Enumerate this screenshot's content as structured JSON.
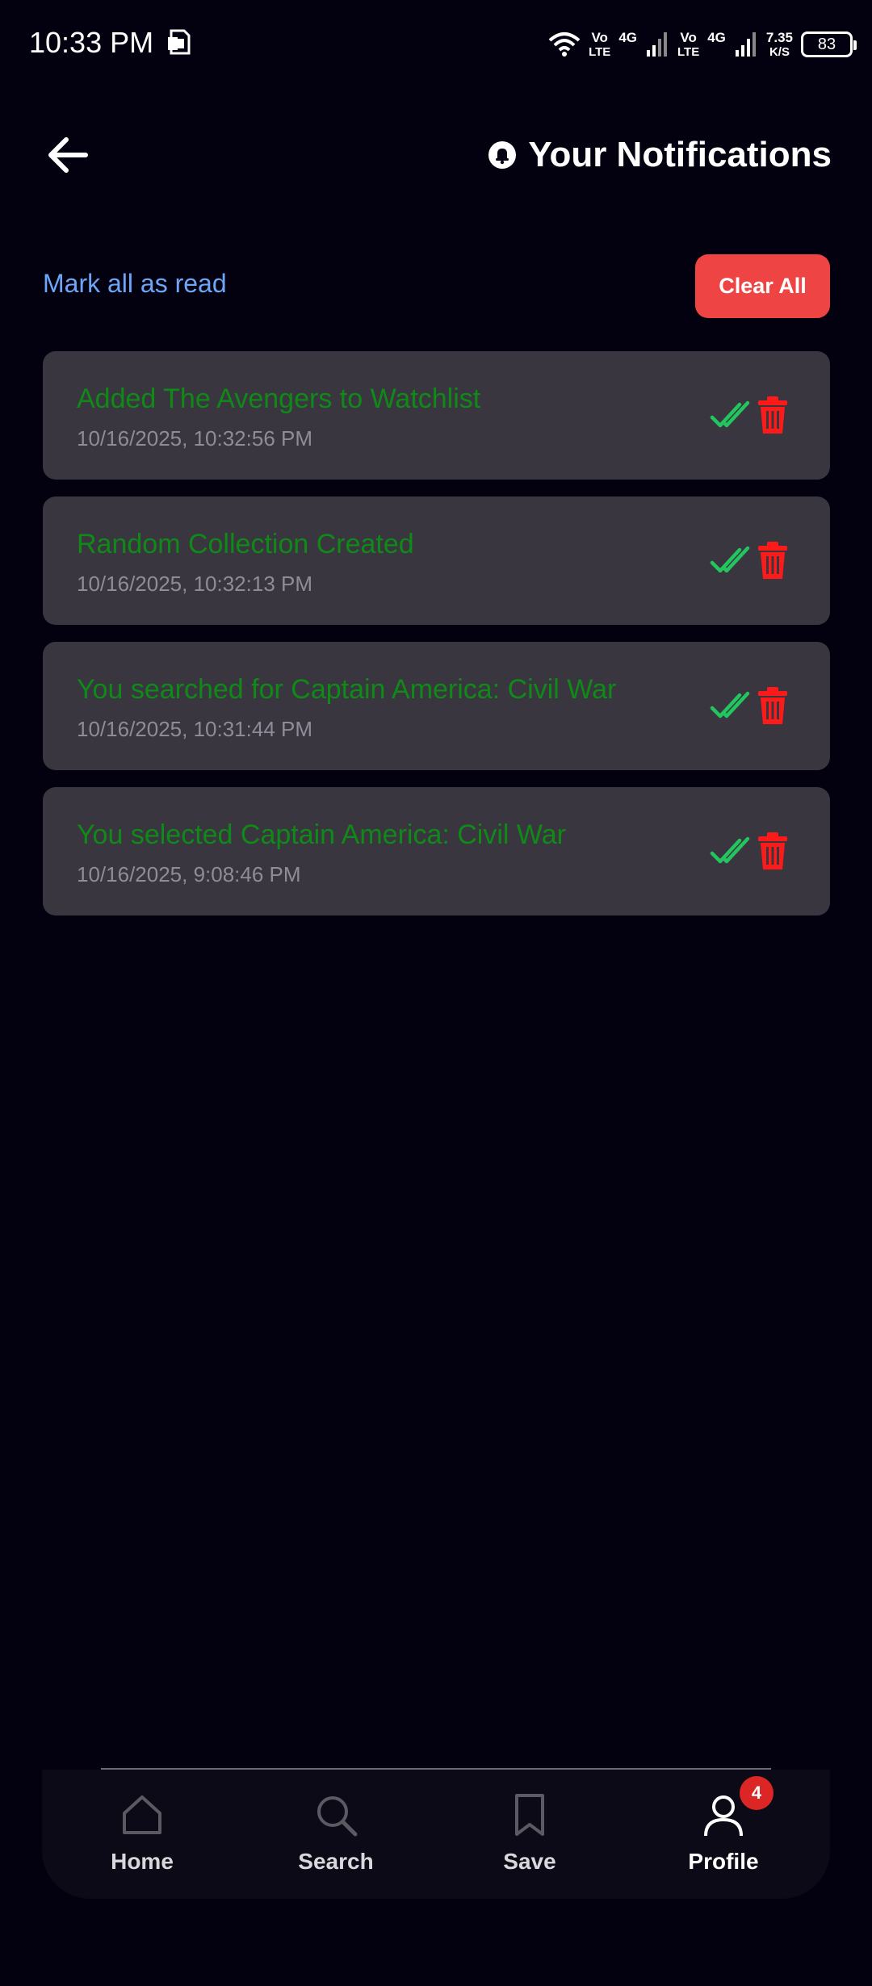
{
  "status_bar": {
    "time": "10:33 PM",
    "net1_top": "Vo",
    "net1_bottom": "LTE",
    "net1_gen": "4G",
    "net2_top": "Vo",
    "net2_bottom": "LTE",
    "net2_gen": "4G",
    "speed_value": "7.35",
    "speed_unit": "K/S",
    "battery": "83"
  },
  "header": {
    "title": "Your Notifications",
    "back_icon": "arrow-left-icon",
    "title_icon": "bell-icon"
  },
  "actions": {
    "mark_all_label": "Mark all as read",
    "clear_all_label": "Clear All"
  },
  "notifications": [
    {
      "title": "Added The Avengers to Watchlist",
      "time": "10/16/2025, 10:32:56 PM"
    },
    {
      "title": "Random Collection Created",
      "time": "10/16/2025, 10:32:13 PM"
    },
    {
      "title": "You searched for Captain America: Civil War",
      "time": "10/16/2025, 10:31:44 PM"
    },
    {
      "title": "You selected Captain America: Civil War",
      "time": "10/16/2025, 9:08:46 PM"
    }
  ],
  "nav": {
    "items": [
      {
        "label": "Home",
        "icon": "home-icon"
      },
      {
        "label": "Search",
        "icon": "search-icon"
      },
      {
        "label": "Save",
        "icon": "bookmark-icon"
      },
      {
        "label": "Profile",
        "icon": "user-icon",
        "badge": "4"
      }
    ]
  },
  "colors": {
    "background": "#03010f",
    "card": "#393640",
    "notification_title": "#0f8a17",
    "link": "#6ea6f7",
    "danger": "#ef4444",
    "check": "#22c55e"
  }
}
